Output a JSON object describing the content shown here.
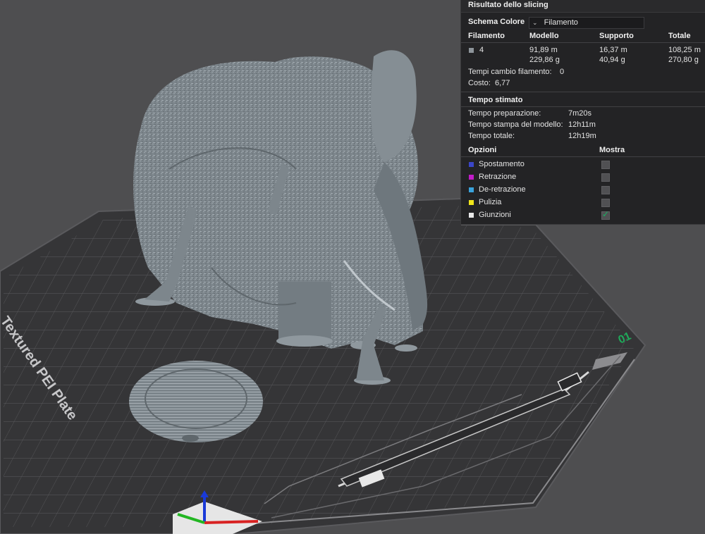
{
  "panel": {
    "title": "Risultato dello slicing",
    "scheme_label": "Schema Colore",
    "scheme_value": "Filamento",
    "table_headers": [
      "Filamento",
      "Modello",
      "Supporto",
      "Totale"
    ],
    "filament_row": {
      "id": "4",
      "color": "#8e959b",
      "model_length": "91,89 m",
      "model_weight": "229,86 g",
      "support_length": "16,37 m",
      "support_weight": "40,94 g",
      "total_length": "108,25 m",
      "total_weight": "270,80 g"
    },
    "filament_changes_label": "Tempi cambio filamento:",
    "filament_changes_value": "0",
    "cost_label": "Costo:",
    "cost_value": "6,77",
    "estimated_time_header": "Tempo stimato",
    "times": [
      {
        "label": "Tempo preparazione:",
        "value": "7m20s"
      },
      {
        "label": "Tempo stampa del modello:",
        "value": "12h11m"
      },
      {
        "label": "Tempo totale:",
        "value": "12h19m"
      }
    ],
    "options_header": "Opzioni",
    "show_header": "Mostra",
    "options": [
      {
        "label": "Spostamento",
        "color": "#3a46c8",
        "checked": false
      },
      {
        "label": "Retrazione",
        "color": "#c21cc9",
        "checked": false
      },
      {
        "label": "De-retrazione",
        "color": "#3aa3dc",
        "checked": false
      },
      {
        "label": "Pulizia",
        "color": "#f0e51a",
        "checked": false
      },
      {
        "label": "Giunzioni",
        "color": "#e8e8e8",
        "checked": true
      }
    ]
  },
  "plate": {
    "name_text": "Textured PEI Plate",
    "number": "01",
    "number_color": "#1faa5a"
  },
  "icons": {
    "checkmark": "check-icon",
    "dropdown": "chevron-down-icon"
  }
}
